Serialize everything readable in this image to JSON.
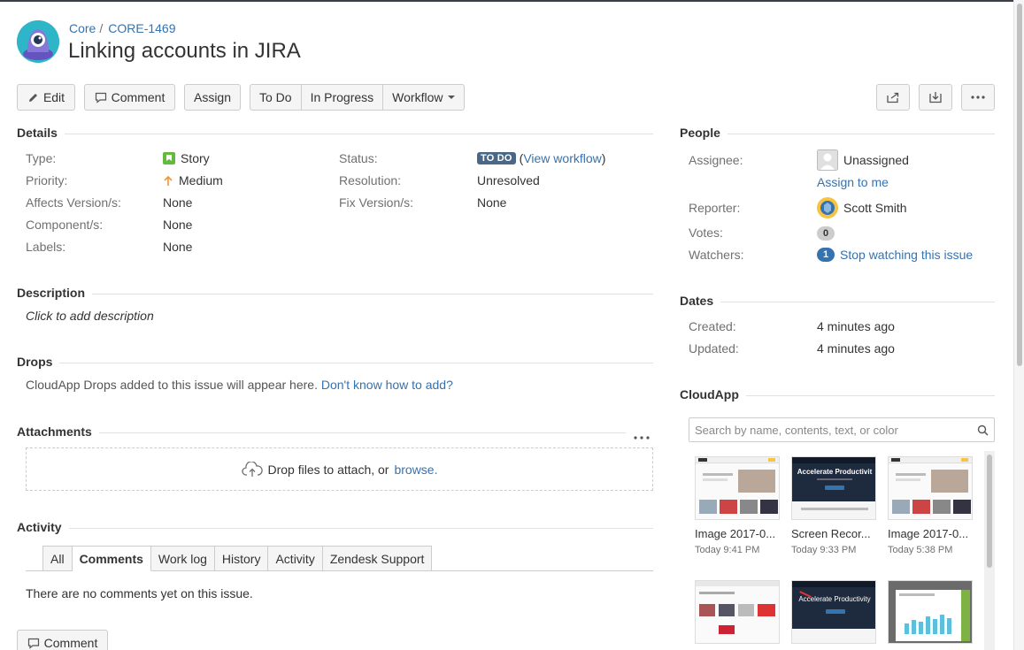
{
  "breadcrumb": {
    "project": "Core",
    "issue_key": "CORE-1469"
  },
  "issue": {
    "title": "Linking accounts in JIRA"
  },
  "toolbar": {
    "edit": "Edit",
    "comment": "Comment",
    "assign": "Assign",
    "to_do": "To Do",
    "in_progress": "In Progress",
    "workflow": "Workflow"
  },
  "details": {
    "heading": "Details",
    "type_label": "Type:",
    "type_value": "Story",
    "priority_label": "Priority:",
    "priority_value": "Medium",
    "affects_label": "Affects Version/s:",
    "affects_value": "None",
    "component_label": "Component/s:",
    "component_value": "None",
    "labels_label": "Labels:",
    "labels_value": "None",
    "status_label": "Status:",
    "status_value": "TO DO",
    "view_workflow": "View workflow",
    "resolution_label": "Resolution:",
    "resolution_value": "Unresolved",
    "fix_label": "Fix Version/s:",
    "fix_value": "None"
  },
  "description": {
    "heading": "Description",
    "placeholder": "Click to add description"
  },
  "drops": {
    "heading": "Drops",
    "text": "CloudApp Drops added to this issue will appear here.",
    "link": "Don't know how to add?"
  },
  "attachments": {
    "heading": "Attachments",
    "drop_text": "Drop files to attach, or",
    "browse": "browse."
  },
  "activity": {
    "heading": "Activity",
    "tabs": [
      "All",
      "Comments",
      "Work log",
      "History",
      "Activity",
      "Zendesk Support"
    ],
    "active_tab": "Comments",
    "empty": "There are no comments yet on this issue.",
    "comment_button": "Comment"
  },
  "people": {
    "heading": "People",
    "assignee_label": "Assignee:",
    "assignee_value": "Unassigned",
    "assign_to_me": "Assign to me",
    "reporter_label": "Reporter:",
    "reporter_value": "Scott Smith",
    "votes_label": "Votes:",
    "votes_count": "0",
    "watchers_label": "Watchers:",
    "watchers_count": "1",
    "watch_link": "Stop watching this issue"
  },
  "dates": {
    "heading": "Dates",
    "created_label": "Created:",
    "created_value": "4 minutes ago",
    "updated_label": "Updated:",
    "updated_value": "4 minutes ago"
  },
  "cloudapp": {
    "heading": "CloudApp",
    "search_placeholder": "Search by name, contents, text, or color",
    "items": [
      {
        "name": "Image 2017-0...",
        "time": "Today 9:41 PM"
      },
      {
        "name": "Screen Recor...",
        "time": "Today 9:33 PM"
      },
      {
        "name": "Image 2017-0...",
        "time": "Today 5:38 PM"
      }
    ],
    "thumb_text": "Accelerate Productivit",
    "thumb_text_2": "Accelerate Productivity"
  },
  "colors": {
    "link": "#3572b0",
    "lozenge": "#4a6785",
    "story": "#63ba3c",
    "priority": "#f79232"
  }
}
